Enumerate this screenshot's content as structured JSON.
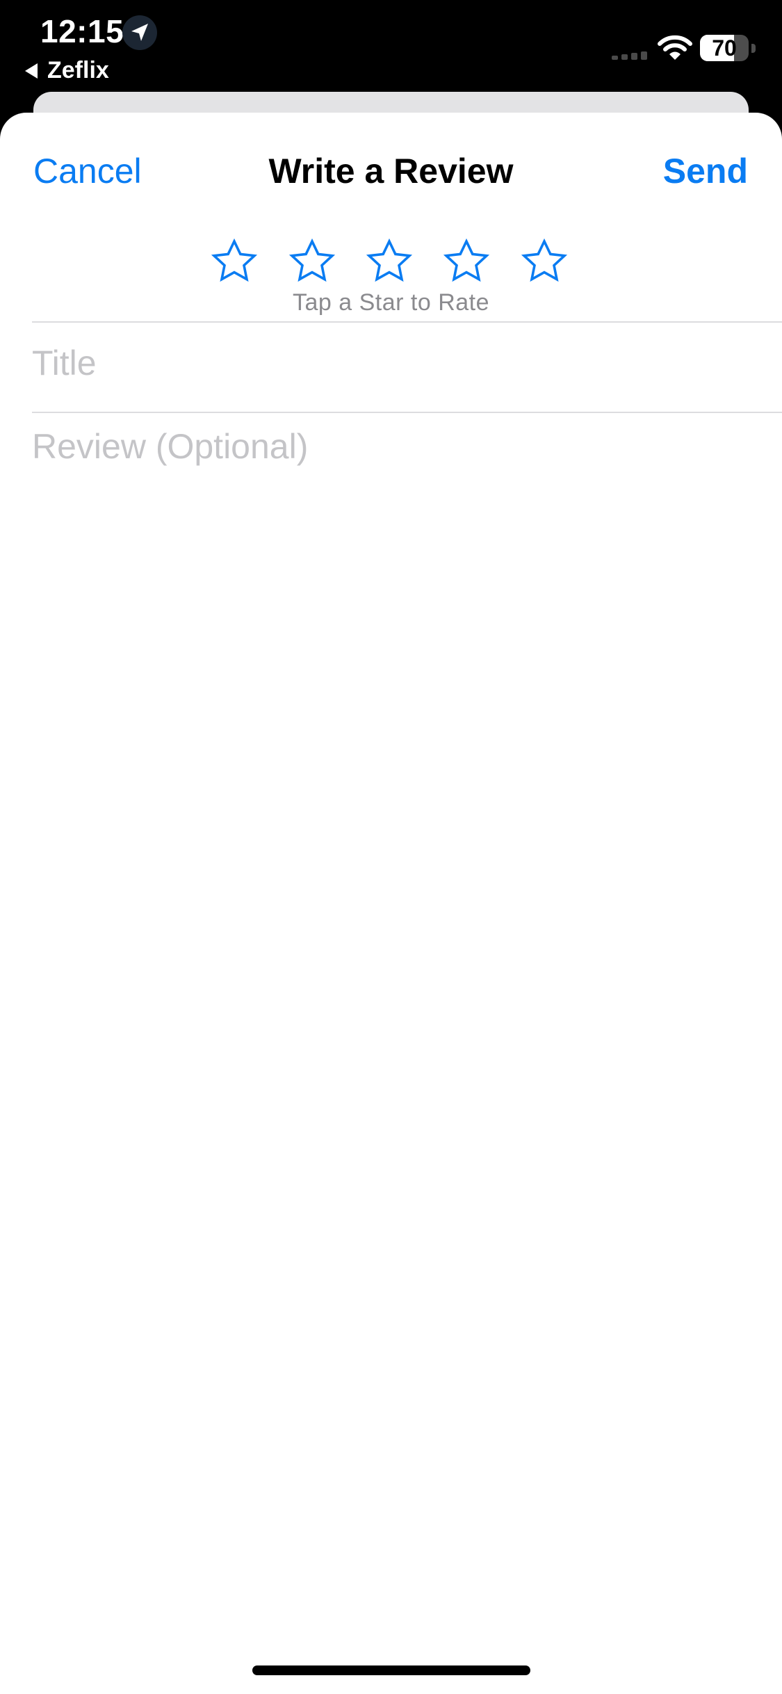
{
  "status_bar": {
    "time": "12:15",
    "back_app": "Zeflix",
    "battery_level": 70,
    "battery_text": "70",
    "icons": [
      "location-arrow-icon",
      "cellular-signal-icon",
      "wifi-icon",
      "battery-icon"
    ]
  },
  "nav": {
    "cancel_label": "Cancel",
    "title": "Write a Review",
    "send_label": "Send"
  },
  "rating": {
    "star_count": 5,
    "selected": 0,
    "hint": "Tap a Star to Rate",
    "star_icon": "star-outline-icon"
  },
  "form": {
    "title_placeholder": "Title",
    "title_value": "",
    "review_placeholder": "Review (Optional)",
    "review_value": ""
  },
  "colors": {
    "accent": "#0a7cf2",
    "placeholder": "#c4c4c7",
    "hint": "#8a8a8e",
    "divider": "#dcdcdf"
  }
}
